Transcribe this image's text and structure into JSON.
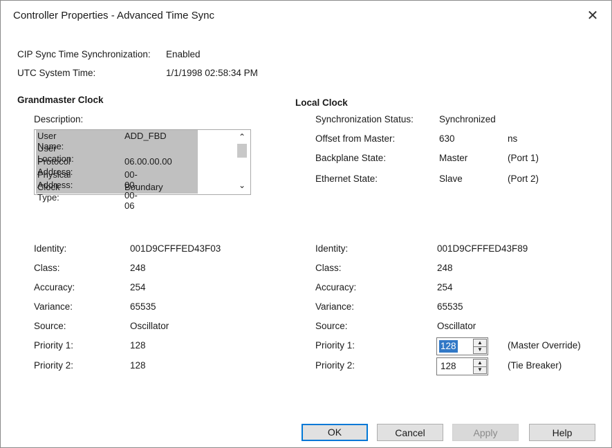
{
  "window": {
    "title": "Controller Properties - Advanced Time Sync",
    "close_glyph": "✕"
  },
  "top": {
    "cip_label": "CIP Sync Time Synchronization:",
    "cip_value": "Enabled",
    "utc_label": "UTC System Time:",
    "utc_value": "1/1/1998 02:58:34 PM"
  },
  "grandmaster": {
    "heading": "Grandmaster Clock",
    "description_label": "Description:",
    "list": [
      {
        "key": "User Name:",
        "value": "ADD_FBD"
      },
      {
        "key": "User Location:",
        "value": ""
      },
      {
        "key": "Protocol Address:",
        "value": "06.00.00.00"
      },
      {
        "key": "Physical Address:",
        "value": "00-00-00-06"
      },
      {
        "key": "Clock Type:",
        "value": "Boundary"
      }
    ],
    "scroll_up_glyph": "⌃",
    "scroll_down_glyph": "⌄",
    "fields": [
      {
        "label": "Identity:",
        "value": "001D9CFFFED43F03"
      },
      {
        "label": "Class:",
        "value": "248"
      },
      {
        "label": "Accuracy:",
        "value": "254"
      },
      {
        "label": "Variance:",
        "value": "65535"
      },
      {
        "label": "Source:",
        "value": "Oscillator"
      },
      {
        "label": "Priority 1:",
        "value": "128"
      },
      {
        "label": "Priority 2:",
        "value": "128"
      }
    ]
  },
  "local": {
    "heading": "Local Clock",
    "status": [
      {
        "label": "Synchronization Status:",
        "value": "Synchronized",
        "extra": ""
      },
      {
        "label": "Offset from Master:",
        "value": "630",
        "extra": "ns"
      },
      {
        "label": "Backplane State:",
        "value": "Master",
        "extra": "(Port 1)"
      },
      {
        "label": "Ethernet State:",
        "value": "Slave",
        "extra": "(Port 2)"
      }
    ],
    "fields": [
      {
        "label": "Identity:",
        "value": "001D9CFFFED43F89"
      },
      {
        "label": "Class:",
        "value": "248"
      },
      {
        "label": "Accuracy:",
        "value": "254"
      },
      {
        "label": "Variance:",
        "value": "65535"
      },
      {
        "label": "Source:",
        "value": "Oscillator"
      }
    ],
    "priority1": {
      "label": "Priority 1:",
      "value": "128",
      "note": "(Master Override)"
    },
    "priority2": {
      "label": "Priority 2:",
      "value": "128",
      "note": "(Tie Breaker)"
    },
    "spin_up_glyph": "▲",
    "spin_down_glyph": "▼"
  },
  "buttons": {
    "ok": "OK",
    "cancel": "Cancel",
    "apply": "Apply",
    "help": "Help"
  }
}
